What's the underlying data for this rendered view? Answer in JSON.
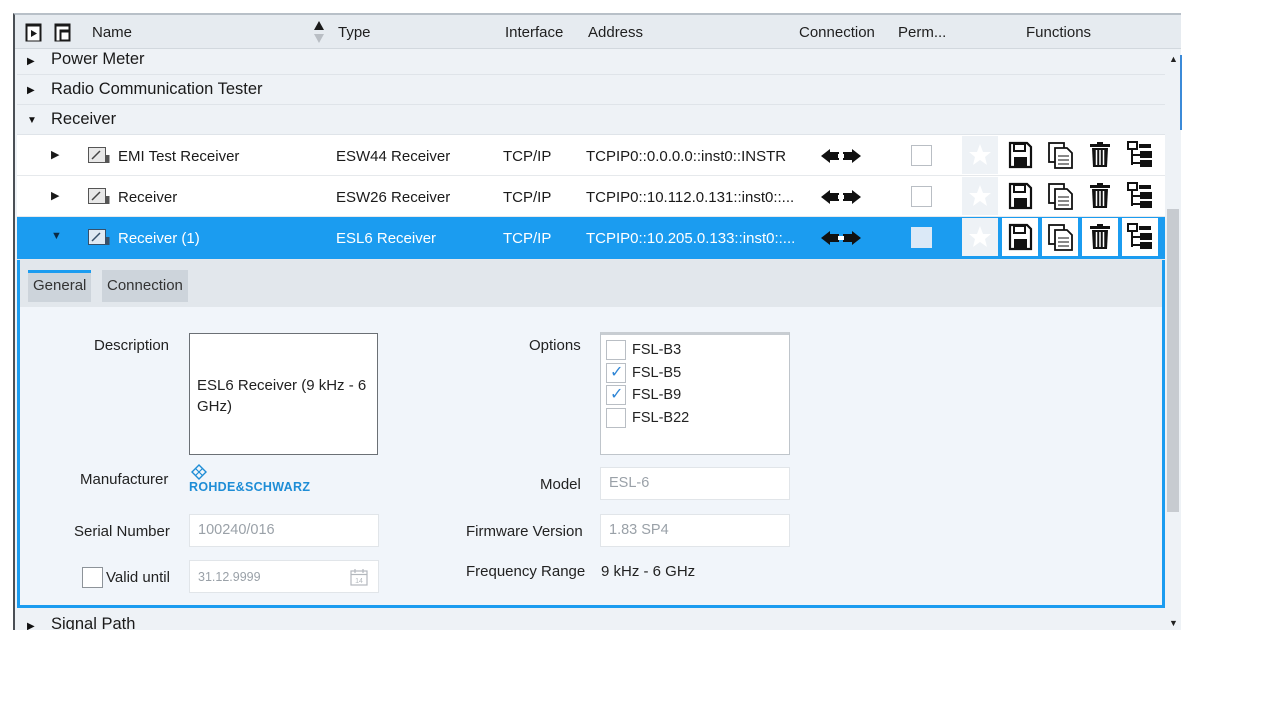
{
  "header": {
    "columns": {
      "name": "Name",
      "type": "Type",
      "interface": "Interface",
      "address": "Address",
      "connection": "Connection",
      "permanent": "Perm...",
      "functions": "Functions"
    }
  },
  "tree": {
    "groups": {
      "power_meter": "Power Meter",
      "radio_tester": "Radio Communication Tester",
      "receiver": "Receiver",
      "signal_path": "Signal Path"
    },
    "rows": [
      {
        "name": "EMI Test Receiver",
        "type": "ESW44 Receiver",
        "interface": "TCP/IP",
        "address": "TCPIP0::0.0.0.0::inst0::INSTR",
        "selected": false
      },
      {
        "name": "Receiver",
        "type": "ESW26 Receiver",
        "interface": "TCP/IP",
        "address": "TCPIP0::10.112.0.131::inst0::...",
        "selected": false
      },
      {
        "name": "Receiver (1)",
        "type": "ESL6 Receiver",
        "interface": "TCP/IP",
        "address": "TCPIP0::10.205.0.133::inst0::...",
        "selected": true
      }
    ]
  },
  "detail": {
    "tabs": {
      "general": "General",
      "connection": "Connection"
    },
    "labels": {
      "description": "Description",
      "options": "Options",
      "manufacturer": "Manufacturer",
      "model": "Model",
      "serial": "Serial Number",
      "firmware": "Firmware Version",
      "valid_until": "Valid until",
      "frequency": "Frequency Range"
    },
    "description_line1": "ESL6 Receiver (9 kHz - 6",
    "description_line2": "GHz)",
    "options": [
      {
        "label": "FSL-B3",
        "checked": false
      },
      {
        "label": "FSL-B5",
        "checked": true
      },
      {
        "label": "FSL-B9",
        "checked": true
      },
      {
        "label": "FSL-B22",
        "checked": false
      }
    ],
    "manufacturer_logo_text": "ROHDE&SCHWARZ",
    "model": "ESL-6",
    "serial": "100240/016",
    "firmware": "1.83 SP4",
    "valid_until": "31.12.9999",
    "calendar_day": "14",
    "frequency_range": "9 kHz  -  6 GHz"
  },
  "colors": {
    "selection": "#1b9cf0",
    "accent_text": "#1e8dd6"
  },
  "icons": {
    "connection": "plug-connect-icon",
    "functions": [
      "star-icon",
      "save-icon",
      "copy-icon",
      "delete-icon",
      "tree-structure-icon"
    ]
  }
}
